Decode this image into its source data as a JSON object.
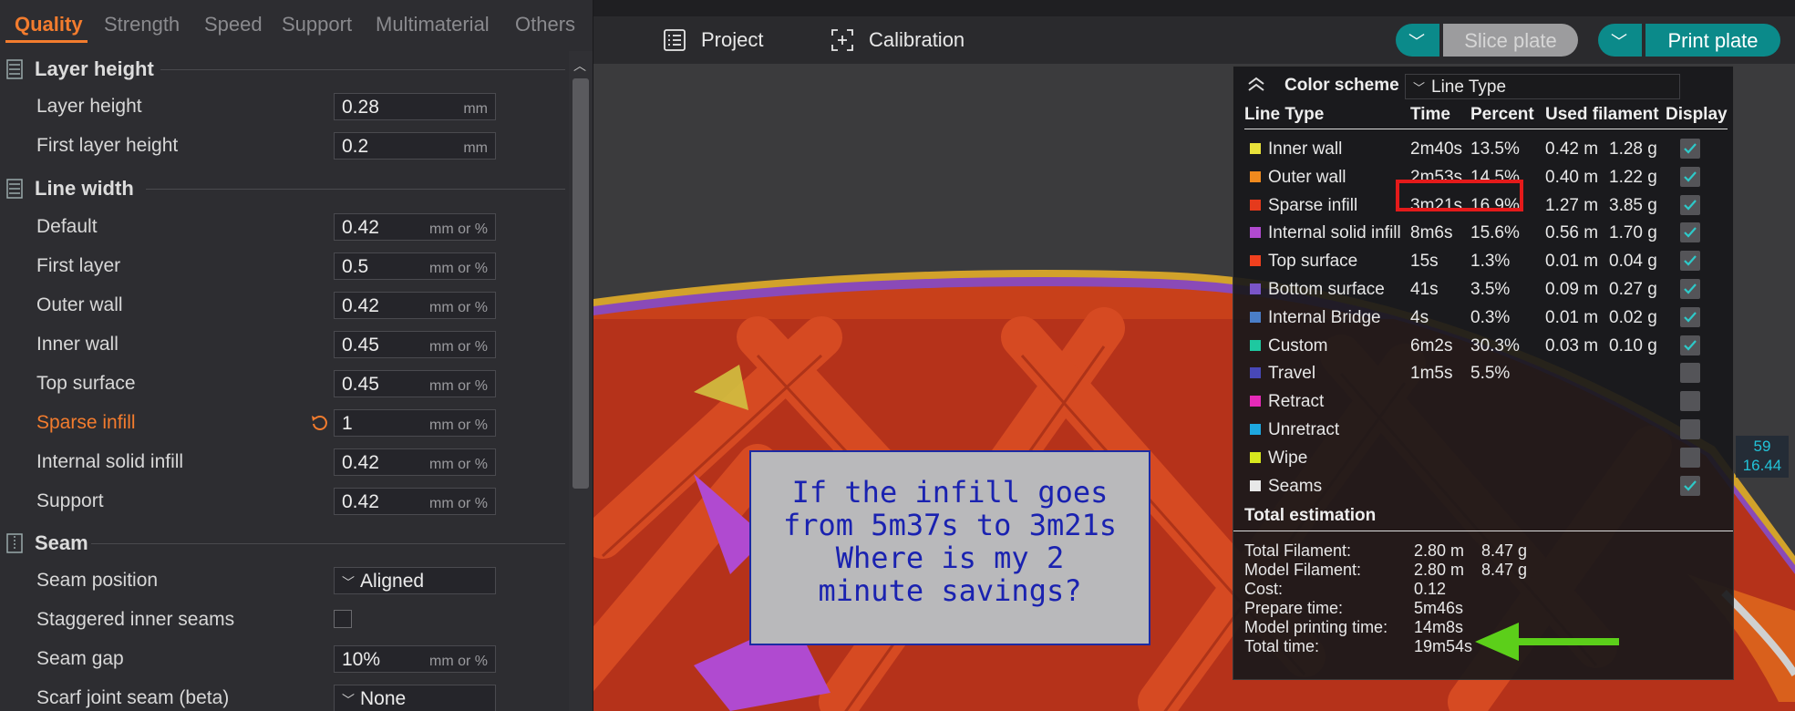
{
  "tabs": {
    "items": [
      "Quality",
      "Strength",
      "Speed",
      "Support",
      "Multimaterial",
      "Others"
    ],
    "active": "Quality"
  },
  "settings": {
    "layer_height_section": "Layer height",
    "line_width_section": "Line width",
    "seam_section": "Seam",
    "rows": [
      {
        "label": "Layer height",
        "value": "0.28",
        "unit": "mm"
      },
      {
        "label": "First layer height",
        "value": "0.2",
        "unit": "mm"
      },
      {
        "label": "Default",
        "value": "0.42",
        "unit": "mm or %"
      },
      {
        "label": "First layer",
        "value": "0.5",
        "unit": "mm or %"
      },
      {
        "label": "Outer wall",
        "value": "0.42",
        "unit": "mm or %"
      },
      {
        "label": "Inner wall",
        "value": "0.45",
        "unit": "mm or %"
      },
      {
        "label": "Top surface",
        "value": "0.45",
        "unit": "mm or %"
      },
      {
        "label": "Sparse infill",
        "value": "1",
        "unit": "mm or %"
      },
      {
        "label": "Internal solid infill",
        "value": "0.42",
        "unit": "mm or %"
      },
      {
        "label": "Support",
        "value": "0.42",
        "unit": "mm or %"
      },
      {
        "label": "Seam position",
        "value": "Aligned"
      },
      {
        "label": "Staggered inner seams",
        "checked": false
      },
      {
        "label": "Seam gap",
        "value": "10%",
        "unit": "mm or %"
      },
      {
        "label": "Scarf joint seam (beta)",
        "value": "None"
      }
    ]
  },
  "toolbar": {
    "project_label": "Project",
    "calibration_label": "Calibration",
    "slice_label": "Slice plate",
    "print_label": "Print plate"
  },
  "legend": {
    "color_scheme_label": "Color scheme",
    "scheme_value": "Line Type",
    "headers": [
      "Line Type",
      "Time",
      "Percent",
      "Used filament",
      "Display"
    ],
    "rows": [
      {
        "name": "Inner wall",
        "color": "#e8e23a",
        "time": "2m40s",
        "percent": "13.5%",
        "length": "0.42 m",
        "weight": "1.28 g",
        "display": true
      },
      {
        "name": "Outer wall",
        "color": "#f08a1e",
        "time": "2m53s",
        "percent": "14.5%",
        "length": "0.40 m",
        "weight": "1.22 g",
        "display": true
      },
      {
        "name": "Sparse infill",
        "color": "#e53a1c",
        "time": "3m21s",
        "percent": "16.9%",
        "length": "1.27 m",
        "weight": "3.85 g",
        "display": true
      },
      {
        "name": "Internal solid infill",
        "color": "#b14ad0",
        "time": "8m6s",
        "percent": "15.6%",
        "length": "0.56 m",
        "weight": "1.70 g",
        "display": true
      },
      {
        "name": "Top surface",
        "color": "#f0401e",
        "time": "15s",
        "percent": "1.3%",
        "length": "0.01 m",
        "weight": "0.04 g",
        "display": true
      },
      {
        "name": "Bottom surface",
        "color": "#7a55c8",
        "time": "41s",
        "percent": "3.5%",
        "length": "0.09 m",
        "weight": "0.27 g",
        "display": true
      },
      {
        "name": "Internal Bridge",
        "color": "#4a7ec8",
        "time": "4s",
        "percent": "0.3%",
        "length": "0.01 m",
        "weight": "0.02 g",
        "display": true
      },
      {
        "name": "Custom",
        "color": "#1ec8a0",
        "time": "6m2s",
        "percent": "30.3%",
        "length": "0.03 m",
        "weight": "0.10 g",
        "display": true
      },
      {
        "name": "Travel",
        "color": "#4848b8",
        "time": "1m5s",
        "percent": "5.5%",
        "length": "",
        "weight": "",
        "display": false
      },
      {
        "name": "Retract",
        "color": "#e62ab8",
        "time": "",
        "percent": "",
        "length": "",
        "weight": "",
        "display": false
      },
      {
        "name": "Unretract",
        "color": "#1ea8e0",
        "time": "",
        "percent": "",
        "length": "",
        "weight": "",
        "display": false
      },
      {
        "name": "Wipe",
        "color": "#d8e81e",
        "time": "",
        "percent": "",
        "length": "",
        "weight": "",
        "display": false
      },
      {
        "name": "Seams",
        "color": "#e8e8e8",
        "time": "",
        "percent": "",
        "length": "",
        "weight": "",
        "display": true
      }
    ],
    "total_title": "Total estimation",
    "totals": [
      {
        "label": "Total Filament:",
        "value": "2.80 m",
        "value2": "8.47 g"
      },
      {
        "label": "Model Filament:",
        "value": "2.80 m",
        "value2": "8.47 g"
      },
      {
        "label": "Cost:",
        "value": "0.12",
        "value2": ""
      },
      {
        "label": "Prepare time:",
        "value": "5m46s",
        "value2": ""
      },
      {
        "label": "Model printing time:",
        "value": "14m8s",
        "value2": ""
      },
      {
        "label": "Total time:",
        "value": "19m54s",
        "value2": ""
      }
    ]
  },
  "annotation": {
    "lines": [
      "If the infill goes",
      "from 5m37s to 3m21s",
      "Where is my 2",
      "minute savings?"
    ]
  },
  "side_readout": {
    "top": "59",
    "bottom": "16.44"
  },
  "colors": {
    "accent": "#f37c2e",
    "teal": "#0b8a8a",
    "highlight": "#e41a1a",
    "arrow": "#5ccf1a"
  }
}
